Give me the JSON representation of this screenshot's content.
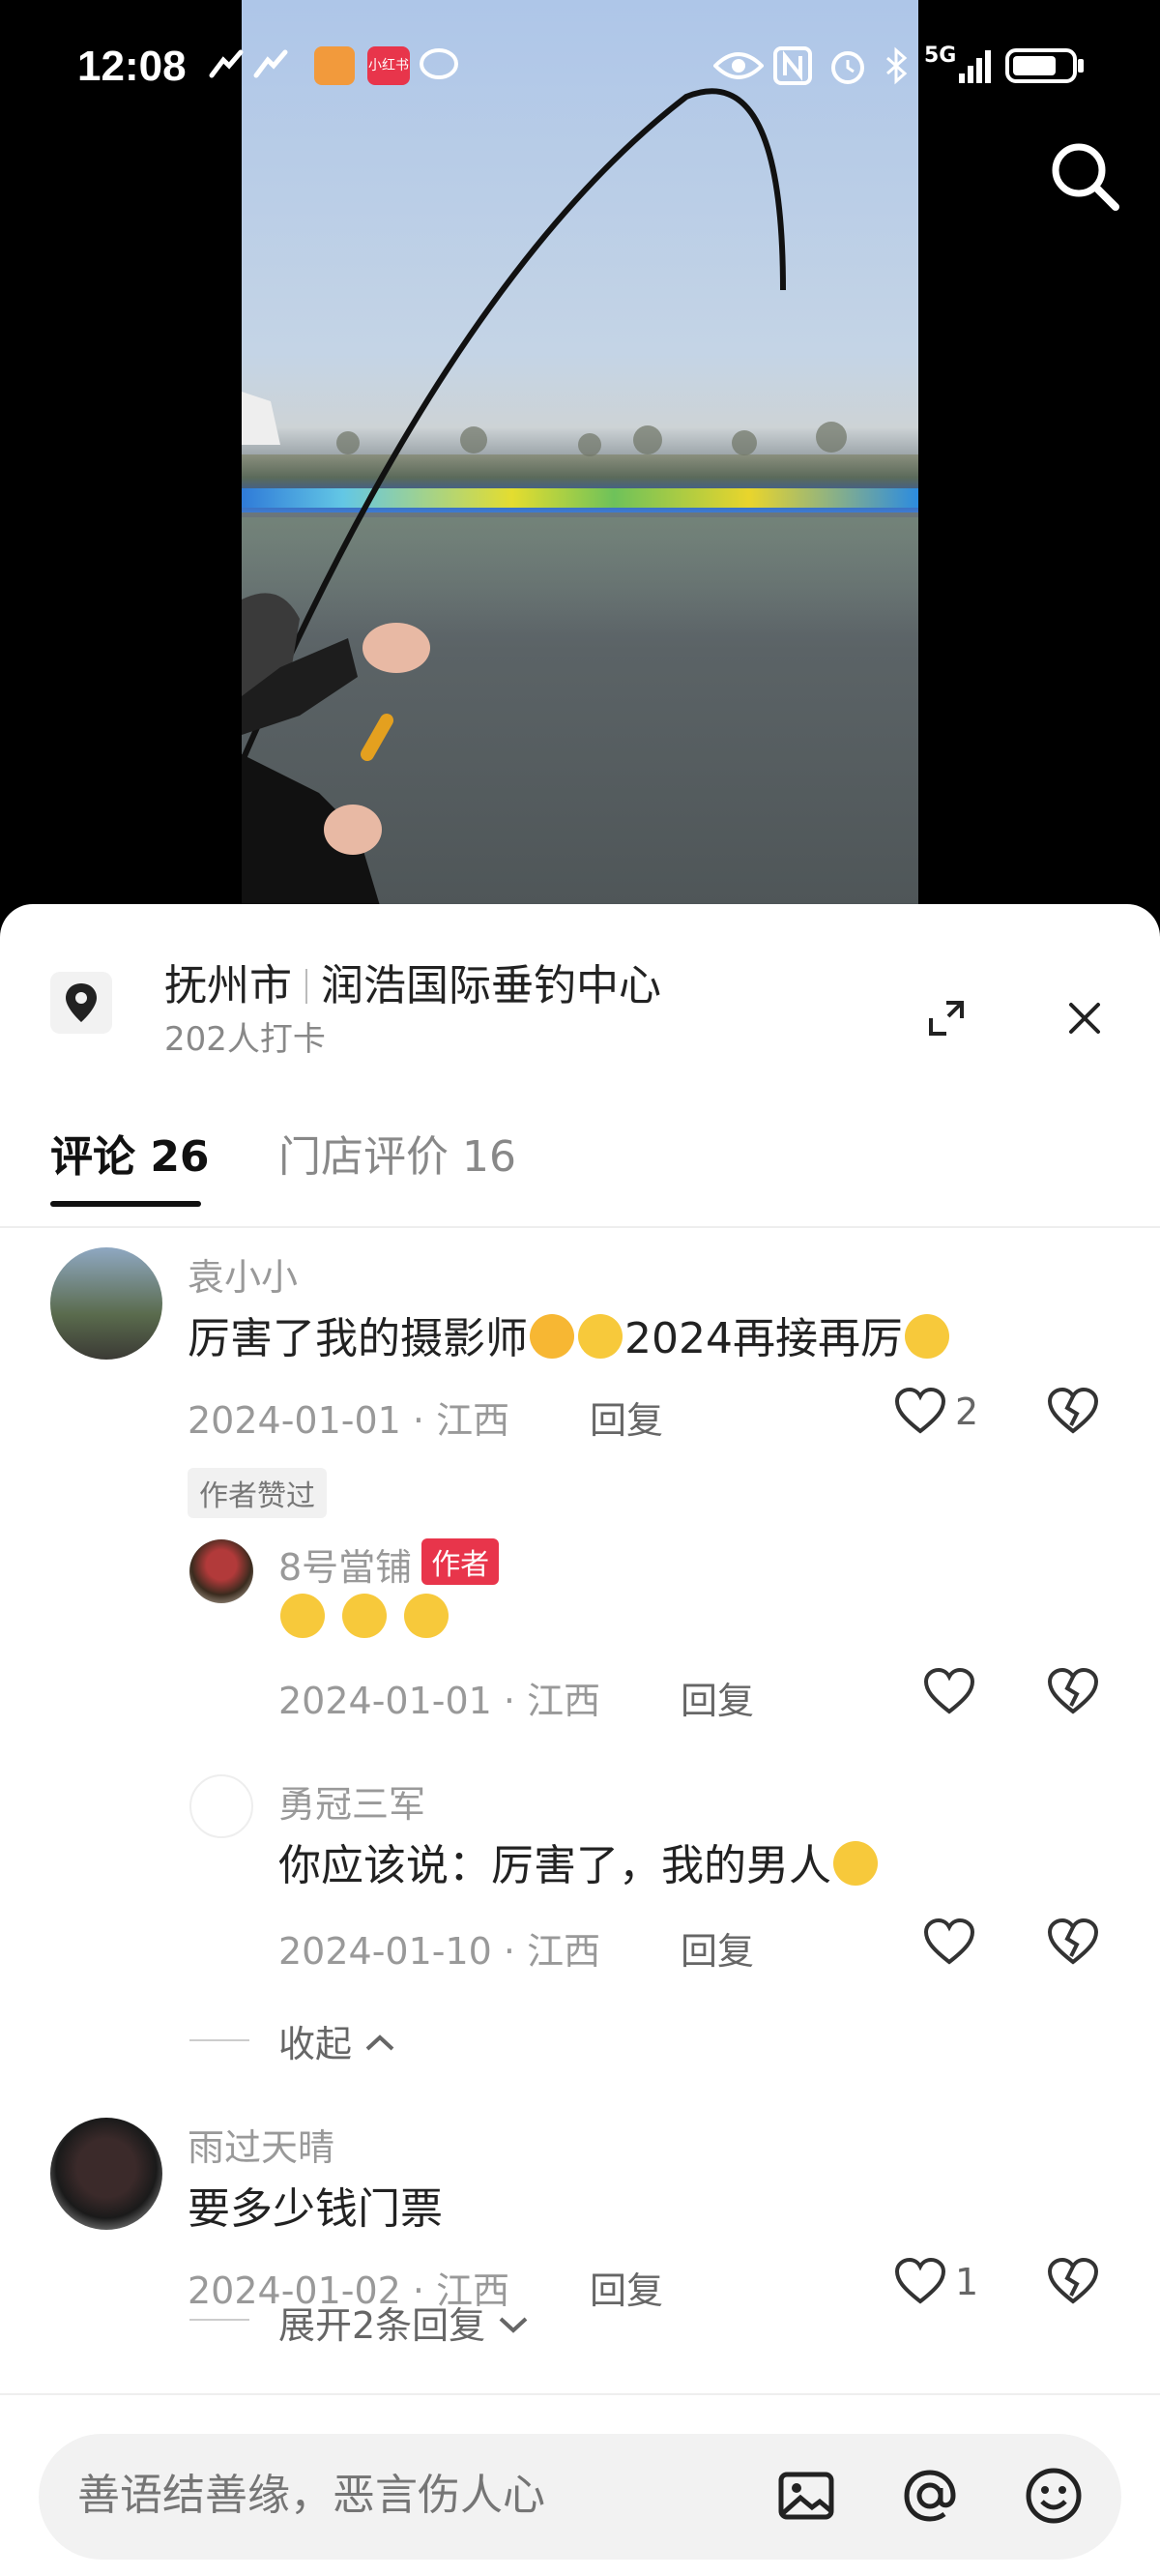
{
  "status_bar": {
    "time": "12:08",
    "network": "5G",
    "app_badge": "小红书"
  },
  "location": {
    "city": "抚州市",
    "venue": "润浩国际垂钓中心",
    "checkins": "202人打卡"
  },
  "tabs": [
    {
      "label": "评论 26"
    },
    {
      "label": "门店评价 16"
    }
  ],
  "comments": [
    {
      "username": "袁小小",
      "text": "厉害了我的摄影师",
      "text_suffix": "2024再接再厉",
      "date": "2024-01-01 · 江西",
      "reply_label": "回复",
      "likes": "2",
      "liked_tag": "作者赞过",
      "replies": [
        {
          "username": "8号當铺",
          "badge": "作者",
          "date": "2024-01-01 · 江西",
          "reply_label": "回复"
        },
        {
          "username": "勇冠三军",
          "text": "你应该说：厉害了，我的男人",
          "date": "2024-01-10 · 江西",
          "reply_label": "回复"
        }
      ],
      "fold_label": "收起"
    },
    {
      "username": "雨过天晴",
      "text": "要多少钱门票",
      "date": "2024-01-02 · 江西",
      "reply_label": "回复",
      "likes": "1",
      "expand_label": "展开2条回复"
    }
  ],
  "input": {
    "placeholder": "善语结善缘，恶言伤人心"
  },
  "colors": {
    "accent": "#e8354b",
    "text": "#222222",
    "muted": "#999999"
  },
  "icons": [
    "search-icon",
    "location-pin-icon",
    "expand-icon",
    "close-icon",
    "heart-icon",
    "broken-heart-icon",
    "image-icon",
    "at-icon",
    "emoji-icon",
    "chevron-up-icon",
    "chevron-down-icon"
  ]
}
